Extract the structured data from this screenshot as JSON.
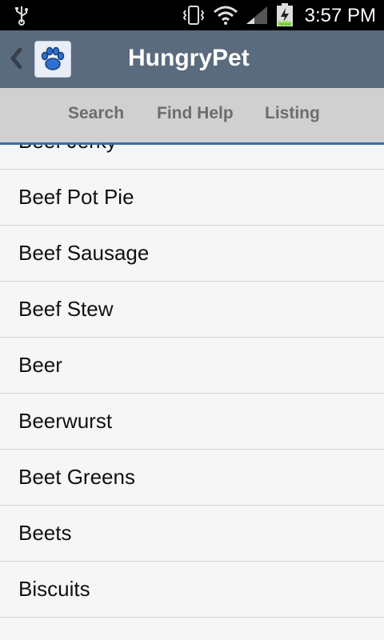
{
  "status_bar": {
    "time": "3:57 PM",
    "battery_percent": "14%",
    "icons": [
      "usb-icon",
      "vibrate-icon",
      "wifi-icon",
      "signal-icon",
      "battery-charging-icon"
    ]
  },
  "action_bar": {
    "title": "HungryPet",
    "icon": "paw-icon",
    "back_icon": "back-chevron-icon",
    "colors": {
      "background": "#5a6b7e"
    }
  },
  "tabs": [
    {
      "label": "Search"
    },
    {
      "label": "Find Help"
    },
    {
      "label": "Listing"
    }
  ],
  "list": {
    "items": [
      {
        "label": "Beef Jerky"
      },
      {
        "label": "Beef Pot Pie"
      },
      {
        "label": "Beef Sausage"
      },
      {
        "label": "Beef Stew"
      },
      {
        "label": "Beer"
      },
      {
        "label": "Beerwurst"
      },
      {
        "label": "Beet Greens"
      },
      {
        "label": "Beets"
      },
      {
        "label": "Biscuits"
      }
    ]
  }
}
